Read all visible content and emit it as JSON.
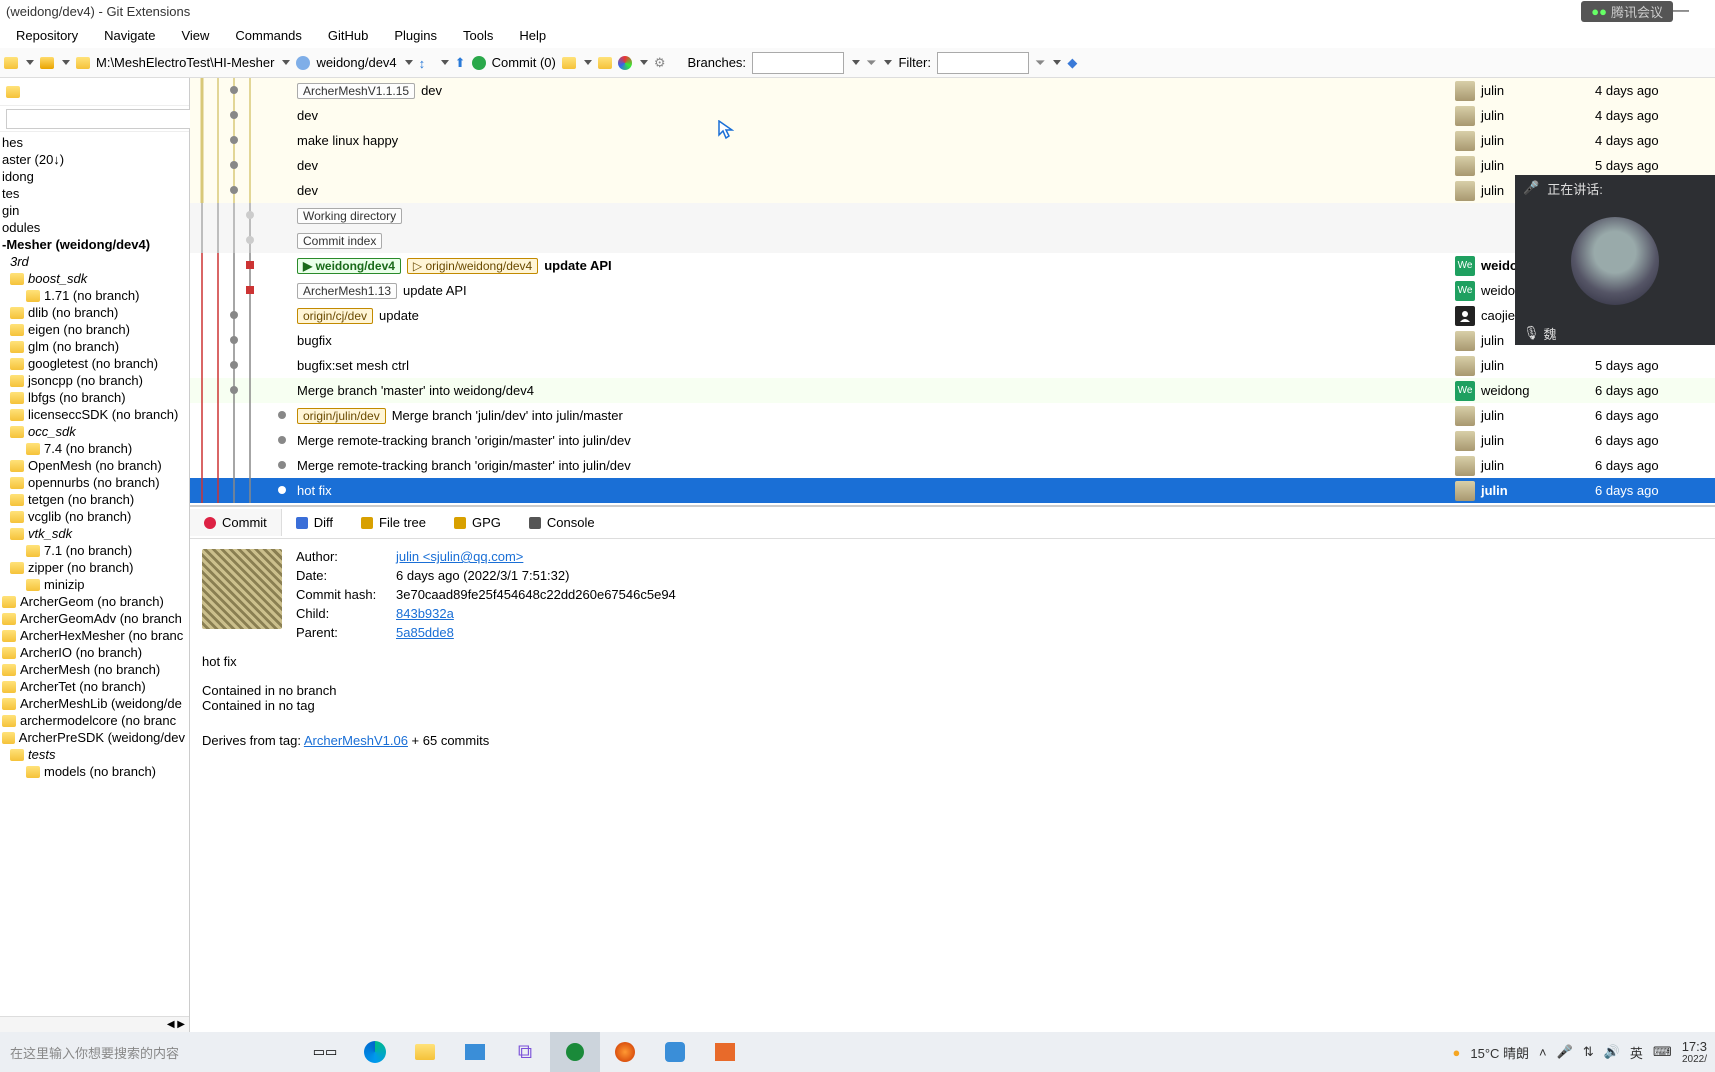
{
  "window": {
    "title": "(weidong/dev4) - Git Extensions",
    "meeting_badge": "腾讯会议"
  },
  "menu": [
    "Repository",
    "Navigate",
    "View",
    "Commands",
    "GitHub",
    "Plugins",
    "Tools",
    "Help"
  ],
  "toolbar": {
    "path": "M:\\MeshElectroTest\\HI-Mesher",
    "branch": "weidong/dev4",
    "commit_label": "Commit (0)",
    "branches_label": "Branches:",
    "filter_label": "Filter:"
  },
  "tree": [
    {
      "d": 0,
      "label": "hes"
    },
    {
      "d": 0,
      "label": "aster (20↓)"
    },
    {
      "d": 0,
      "label": "idong"
    },
    {
      "d": 0,
      "label": "tes"
    },
    {
      "d": 0,
      "label": "gin"
    },
    {
      "d": 0,
      "label": "odules"
    },
    {
      "d": 0,
      "bold": true,
      "label": "-Mesher (weidong/dev4)"
    },
    {
      "d": 1,
      "italic": true,
      "label": "3rd"
    },
    {
      "d": 1,
      "italic": true,
      "folder": true,
      "label": "boost_sdk"
    },
    {
      "d": 2,
      "folder": true,
      "label": "1.71 (no branch)"
    },
    {
      "d": 1,
      "folder": true,
      "label": "dlib (no branch)"
    },
    {
      "d": 1,
      "folder": true,
      "label": "eigen (no branch)"
    },
    {
      "d": 1,
      "folder": true,
      "label": "glm (no branch)"
    },
    {
      "d": 1,
      "folder": true,
      "label": "googletest (no branch)"
    },
    {
      "d": 1,
      "folder": true,
      "label": "jsoncpp (no branch)"
    },
    {
      "d": 1,
      "folder": true,
      "label": "lbfgs (no branch)"
    },
    {
      "d": 1,
      "folder": true,
      "label": "licenseccSDK (no branch)"
    },
    {
      "d": 1,
      "italic": true,
      "folder": true,
      "label": "occ_sdk"
    },
    {
      "d": 2,
      "folder": true,
      "label": "7.4 (no branch)"
    },
    {
      "d": 1,
      "folder": true,
      "label": "OpenMesh (no branch)"
    },
    {
      "d": 1,
      "folder": true,
      "label": "opennurbs (no branch)"
    },
    {
      "d": 1,
      "folder": true,
      "label": "tetgen (no branch)"
    },
    {
      "d": 1,
      "folder": true,
      "label": "vcglib (no branch)"
    },
    {
      "d": 1,
      "italic": true,
      "folder": true,
      "label": "vtk_sdk"
    },
    {
      "d": 2,
      "folder": true,
      "label": "7.1 (no branch)"
    },
    {
      "d": 1,
      "folder": true,
      "label": "zipper (no branch)"
    },
    {
      "d": 2,
      "folder": true,
      "label": "minizip"
    },
    {
      "d": 0,
      "folder": true,
      "label": "ArcherGeom (no branch)"
    },
    {
      "d": 0,
      "folder": true,
      "label": "ArcherGeomAdv (no branch"
    },
    {
      "d": 0,
      "folder": true,
      "label": "ArcherHexMesher (no branc"
    },
    {
      "d": 0,
      "folder": true,
      "label": "ArcherIO (no branch)"
    },
    {
      "d": 0,
      "folder": true,
      "label": "ArcherMesh (no branch)"
    },
    {
      "d": 0,
      "folder": true,
      "label": "ArcherTet (no branch)"
    },
    {
      "d": 0,
      "folder": true,
      "label": "ArcherMeshLib (weidong/de"
    },
    {
      "d": 0,
      "folder": true,
      "label": "archermodelcore (no branc"
    },
    {
      "d": 0,
      "folder": true,
      "label": "ArcherPreSDK (weidong/dev"
    },
    {
      "d": 1,
      "italic": true,
      "folder": true,
      "label": "tests"
    },
    {
      "d": 2,
      "folder": true,
      "label": "models (no branch)"
    }
  ],
  "commits": [
    {
      "tags": [
        {
          "t": "ArcherMeshV1.1.15"
        }
      ],
      "subj": "dev",
      "author": "julin",
      "av": "p",
      "date": "4 days ago"
    },
    {
      "subj": "dev",
      "author": "julin",
      "av": "p",
      "date": "4 days ago"
    },
    {
      "subj": "make linux happy",
      "author": "julin",
      "av": "p",
      "date": "4 days ago"
    },
    {
      "subj": "dev",
      "author": "julin",
      "av": "p",
      "date": "5 days ago"
    },
    {
      "subj": "dev",
      "author": "julin",
      "av": "p",
      "date": ""
    },
    {
      "wk": true,
      "tags": [
        {
          "t": "Working directory"
        }
      ]
    },
    {
      "wk": true,
      "tags": [
        {
          "t": "Commit index"
        }
      ]
    },
    {
      "tags": [
        {
          "t": "weidong/dev4",
          "cls": "br-local",
          "pre": "▶"
        },
        {
          "t": "origin/weidong/dev4",
          "cls": "br-remote",
          "pre": "▷"
        }
      ],
      "subj": "update API",
      "bold": true,
      "author": "weidong",
      "av": "we",
      "date": ""
    },
    {
      "tags": [
        {
          "t": "ArcherMesh1.13"
        }
      ],
      "subj": "update API",
      "author": "weidong",
      "av": "we",
      "date": ""
    },
    {
      "tags": [
        {
          "t": "origin/cj/dev",
          "cls": "br-remote"
        }
      ],
      "subj": "update",
      "author": "caojie199",
      "av": "sil",
      "date": ""
    },
    {
      "subj": "bugfix",
      "author": "julin",
      "av": "p",
      "date": ""
    },
    {
      "subj": "bugfix:set mesh ctrl",
      "author": "julin",
      "av": "p",
      "date": "5 days ago"
    },
    {
      "subj": "Merge branch 'master' into weidong/dev4",
      "author": "weidong",
      "av": "we",
      "date": "6 days ago"
    },
    {
      "tags": [
        {
          "t": "origin/julin/dev",
          "cls": "br-remote"
        }
      ],
      "subj": "Merge branch 'julin/dev' into julin/master",
      "author": "julin",
      "av": "p",
      "date": "6 days ago"
    },
    {
      "subj": "Merge remote-tracking branch 'origin/master' into julin/dev",
      "author": "julin",
      "av": "p",
      "date": "6 days ago"
    },
    {
      "subj": "Merge remote-tracking branch 'origin/master' into julin/dev",
      "author": "julin",
      "av": "p",
      "date": "6 days ago"
    },
    {
      "selected": true,
      "subj": "hot fix",
      "author": "julin",
      "av": "p",
      "date": "6 days ago"
    }
  ],
  "dtabs": [
    "Commit",
    "Diff",
    "File tree",
    "GPG",
    "Console"
  ],
  "dicons": {
    "Commit": "#d24",
    "Diff": "#3a6ed8",
    "File tree": "#d8a000",
    "GPG": "#d8a000",
    "Console": "#555"
  },
  "detail": {
    "labels": {
      "author": "Author:",
      "date": "Date:",
      "hash": "Commit hash:",
      "child": "Child:",
      "parent": "Parent:"
    },
    "author": "julin <sjulin@qq.com>",
    "date": "6 days ago (2022/3/1 7:51:32)",
    "hash": "3e70caad89fe25f454648c22dd260e67546c5e94",
    "child": "843b932a",
    "parent": "5a85dde8",
    "message": "hot fix",
    "contained_branch": "Contained in no branch",
    "contained_tag": "Contained in no tag",
    "derives_prefix": "Derives from tag: ",
    "derives_tag": "ArcherMeshV1.06",
    "derives_suffix": " + 65 commits"
  },
  "overlay": {
    "speaking": "正在讲话:",
    "user": "魏"
  },
  "taskbar": {
    "search_placeholder": "在这里输入你想要搜索的内容",
    "weather": "15°C 晴朗",
    "ime": "英",
    "time": "17:3",
    "date": "2022/"
  }
}
